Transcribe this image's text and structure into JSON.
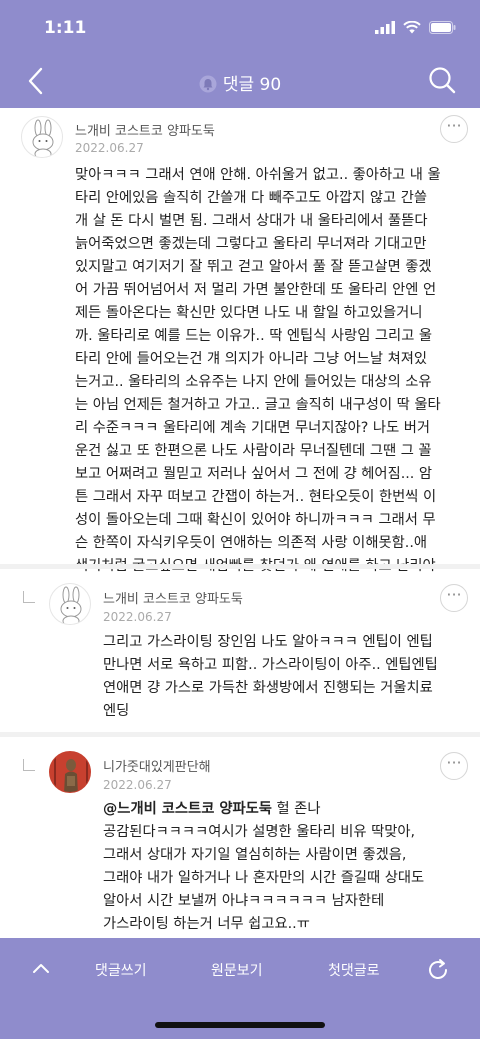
{
  "status_bar": {
    "time": "1:11"
  },
  "header": {
    "title": "댓글 90"
  },
  "comments": [
    {
      "author": "느개비 코스트코 양파도둑",
      "date": "2022.06.27",
      "text": "맞아ㅋㅋㅋ 그래서 연애 안해. 아쉬울거 없고.. 좋아하고 내 울\n타리 안에있음 솔직히 간쓸개 다 빼주고도 아깝지 않고 간쓸\n개 살 돈 다시 벌면 됨. 그래서 상대가 내 울타리에서 풀뜯다\n늙어죽었으면 좋겠는데 그렇다고 울타리 무너져라 기대고만\n있지말고 여기저기 잘 뛰고 걷고 알아서 풀 잘 뜯고살면 좋겠\n어 가끔 뛰어넘어서 저 멀리 가면 불안한데 또 울타리 안엔 언\n제든 돌아온다는 확신만 있다면 나도 내 할일 하고있을거니\n까. 울타리로 예를 드는 이유가.. 딱 엔팁식 사랑임 그리고 울\n타리 안에 들어오는건 걔 의지가 아니라 그냥 어느날 쳐져있\n는거고.. 울타리의 소유주는 나지 안에 들어있는 대상의 소유\n는 아님 언제든 철거하고 가고.. 글고 솔직히 내구성이 딱 울타\n리 수준ㅋㅋㅋ 울타리에 계속 기대면 무너지잖아? 나도 버거\n운건 싫고 또 한편으론 나도 사람이라 무너질텐데 그땐 그 꼴\n보고 어쩌려고 뭘믿고 저러나 싶어서 그 전에 걍 헤어짐... 암\n튼 그래서 자꾸 떠보고 간잽이 하는거.. 현타오듯이 한번씩 이\n성이 돌아오는데 그때 확신이 있어야 하니까ㅋㅋㅋ 그래서 무\n슨 한쪽이 자식키우듯이 연애하는 의존적 사랑 이해못함..애\n색기처럼 굴고싶으면 새엄빠를 찾던가 왜 연애를 하고 난리야"
    },
    {
      "author": "느개비 코스트코 양파도둑",
      "date": "2022.06.27",
      "text": "그리고 가스라이팅 장인임 나도 알아ㅋㅋㅋ 엔팁이 엔팁\n만나면 서로 욕하고 피함.. 가스라이팅이 아주.. 엔팁엔팁\n연애면 걍 가스로 가득찬 화생방에서 진행되는 거울치료\n엔딩"
    },
    {
      "author": "니가줏대있게판단해",
      "date": "2022.06.27",
      "mention": "@느개비 코스트코 양파도둑",
      "text_first": " 헐 존나",
      "text": "공감된다ㅋㅋㅋㅋ여시가 설명한 울타리 비유 딱맞아,\n그래서 상대가 자기일 열심히하는 사람이면 좋겠음,\n그래야 내가 일하거나 나 혼자만의 시간 즐길때 상대도\n알아서 시간 보낼꺼 아냐ㅋㅋㅋㅋㅋㅋ 남자한테\n가스라이팅 하는거 너무 쉽고요..ㅠ"
    }
  ],
  "bottom_bar": {
    "write_label": "댓글쓰기",
    "original_label": "원문보기",
    "first_label": "첫댓글로"
  },
  "colors": {
    "accent": "#8f8ccc"
  }
}
